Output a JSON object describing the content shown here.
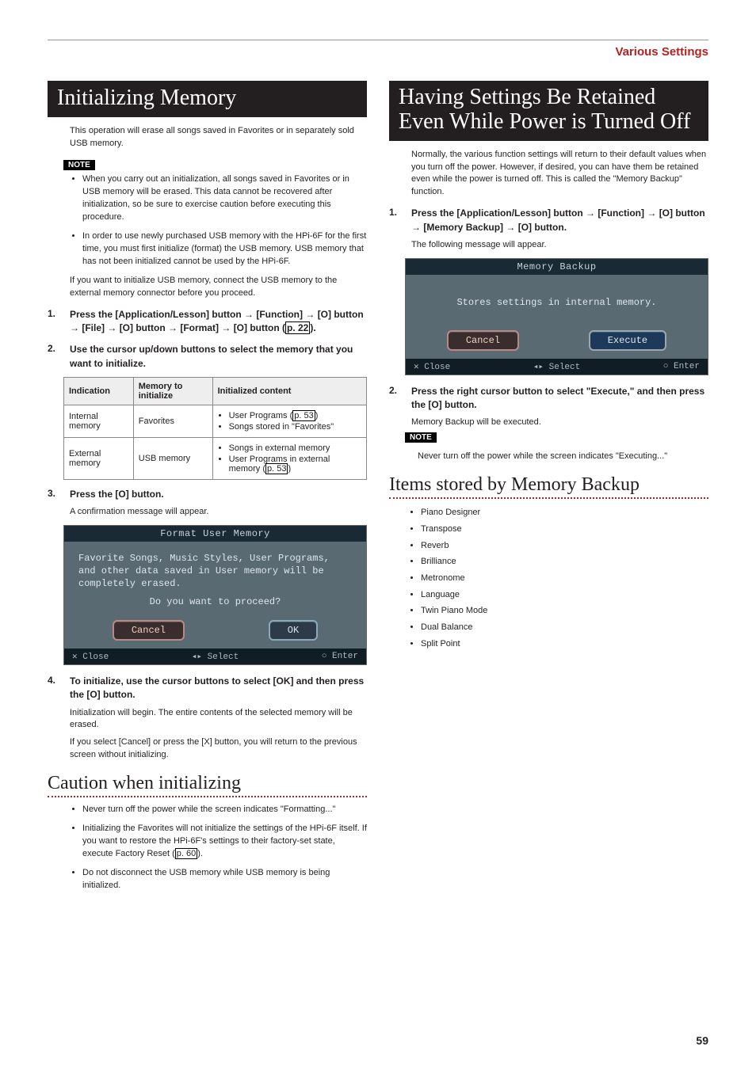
{
  "header": {
    "title": "Various Settings"
  },
  "page_number": "59",
  "left": {
    "section_title": "Initializing Memory",
    "intro": "This operation will erase all songs saved in Favorites or in separately sold USB memory.",
    "note_label": "NOTE",
    "notes": [
      "When you carry out an initialization, all songs saved in Favorites or in USB memory will be erased. This data cannot be recovered after initialization, so be sure to exercise caution before executing this procedure.",
      "In order to use newly purchased USB memory with the HPi-6F for the first time, you must first initialize (format) the USB memory. USB memory that has not been initialized cannot be used by the HPi-6F."
    ],
    "after_notes": "If you want to initialize USB memory, connect the USB memory to the external memory connector before you proceed.",
    "step1_num": "1.",
    "step1_a": "Press the [Application/Lesson] button ",
    "step1_b": " [Function] ",
    "step1_c": " [O] button ",
    "step1_d": " [File] ",
    "step1_e": " [O] button ",
    "step1_f": " [Format] ",
    "step1_g": " [O] button (",
    "step1_pref": "p. 22",
    "step1_h": ").",
    "step2_num": "2.",
    "step2": "Use the cursor up/down buttons to select the memory that you want to initialize.",
    "table": {
      "h1": "Indication",
      "h2": "Memory to initialize",
      "h3": "Initialized content",
      "r1c1": "Internal memory",
      "r1c2": "Favorites",
      "r1c3a": "User Programs (",
      "r1c3a_p": "p. 53",
      "r1c3a_end": ")",
      "r1c3b": "Songs stored in \"Favorites\"",
      "r2c1": "External memory",
      "r2c2": "USB memory",
      "r2c3a": "Songs in external memory",
      "r2c3b": "User Programs in external memory (",
      "r2c3b_p": "p. 53",
      "r2c3b_end": ")"
    },
    "step3_num": "3.",
    "step3": "Press the [O] button.",
    "step3_sub": "A confirmation message will appear.",
    "lcd1": {
      "title": "Format User Memory",
      "line1": "Favorite Songs, Music Styles, User Programs, and other data saved in User memory will be completely erased.",
      "line2": "Do you want to proceed?",
      "cancel": "Cancel",
      "ok": "OK",
      "fclose": "✕ Close",
      "fselect": "◂▸ Select",
      "fenter": "○ Enter"
    },
    "step4_num": "4.",
    "step4": "To initialize, use the cursor buttons to select [OK] and then press the [O] button.",
    "step4_sub1": "Initialization will begin. The entire contents of the selected memory will be erased.",
    "step4_sub2": "If you select [Cancel] or press the [X] button, you will return to the previous screen without initializing.",
    "caution_title": "Caution when initializing",
    "cautions": [
      "Never turn off the power while the screen indicates \"Formatting...\"",
      "Initializing the Favorites will not initialize the settings of the HPi-6F itself. If you want to restore the HPi-6F's settings to their factory-set state, execute Factory Reset (",
      "Do not disconnect the USB memory while USB memory is being initialized."
    ],
    "caution2_p": "p. 60",
    "caution2_end": ")."
  },
  "right": {
    "section_title": "Having Settings Be Retained Even While Power is Turned Off",
    "intro": "Normally, the various function settings will return to their default values when you turn off the power. However, if desired, you can have them be retained even while the power is turned off. This is called the \"Memory Backup\" function.",
    "step1_num": "1.",
    "step1_a": "Press the [Application/Lesson] button ",
    "step1_b": " [Function] ",
    "step1_c": " [O] button ",
    "step1_d": " [Memory Backup] ",
    "step1_e": " [O] button.",
    "step1_sub": "The following message will appear.",
    "lcd2": {
      "title": "Memory Backup",
      "line1": "Stores settings in internal memory.",
      "cancel": "Cancel",
      "execute": "Execute",
      "fclose": "✕ Close",
      "fselect": "◂▸ Select",
      "fenter": "○ Enter"
    },
    "step2_num": "2.",
    "step2": "Press the right cursor button to select \"Execute,\" and then press the [O] button.",
    "step2_sub": "Memory Backup will be executed.",
    "note_label": "NOTE",
    "note_text": "Never turn off the power while the screen indicates \"Executing...\"",
    "items_title": "Items stored by Memory Backup",
    "items": [
      "Piano Designer",
      "Transpose",
      "Reverb",
      "Brilliance",
      "Metronome",
      "Language",
      "Twin Piano Mode",
      "Dual Balance",
      "Split Point"
    ]
  }
}
